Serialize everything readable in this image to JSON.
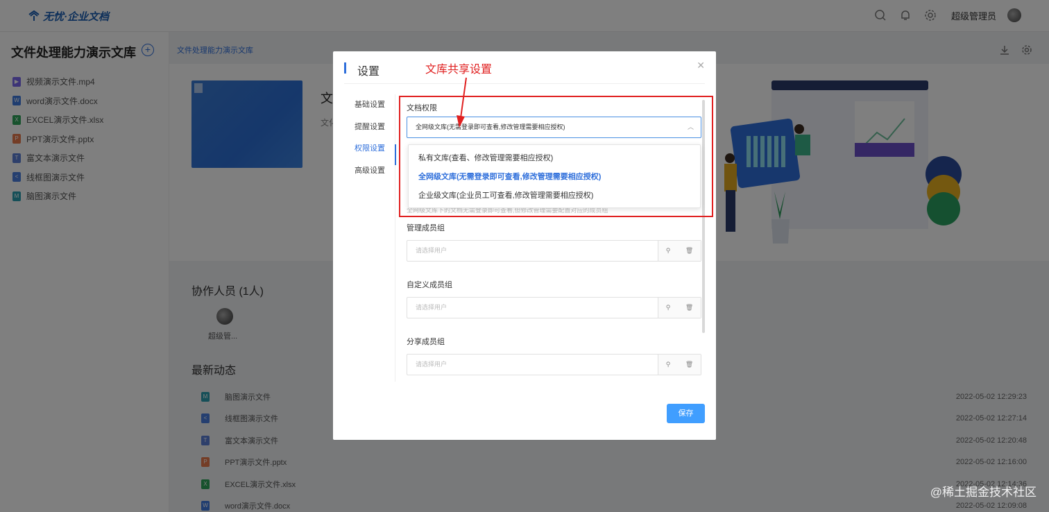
{
  "header": {
    "logo_text": "无忧·企业文档",
    "user_name": "超级管理员"
  },
  "sidebar": {
    "title": "文件处理能力演示文库",
    "files": [
      {
        "name": "视频演示文件.mp4",
        "color": "#7b68ee",
        "glyph": "▶"
      },
      {
        "name": "word演示文件.docx",
        "color": "#3f7be0",
        "glyph": "W"
      },
      {
        "name": "EXCEL演示文件.xlsx",
        "color": "#2fa55a",
        "glyph": "X"
      },
      {
        "name": "PPT演示文件.pptx",
        "color": "#e87a4d",
        "glyph": "P"
      },
      {
        "name": "富文本演示文件",
        "color": "#5b7fd6",
        "glyph": "T"
      },
      {
        "name": "线框图演示文件",
        "color": "#4a7fe0",
        "glyph": "<"
      },
      {
        "name": "脑图演示文件",
        "color": "#2a9fb0",
        "glyph": "M"
      }
    ]
  },
  "main": {
    "breadcrumb": "文件处理能力演示文库",
    "doc_title": "文",
    "doc_sub": "文化",
    "collaborators_title": "协作人员 (1人)",
    "collaborator_name": "超级管...",
    "news_title": "最新动态",
    "news": [
      {
        "name": "脑图演示文件",
        "time": "2022-05-02 12:29:23",
        "color": "#2a9fb0",
        "glyph": "M"
      },
      {
        "name": "线框图演示文件",
        "time": "2022-05-02 12:27:14",
        "color": "#4a7fe0",
        "glyph": "<"
      },
      {
        "name": "富文本演示文件",
        "time": "2022-05-02 12:20:48",
        "color": "#5b7fd6",
        "glyph": "T"
      },
      {
        "name": "PPT演示文件.pptx",
        "time": "2022-05-02 12:16:00",
        "color": "#e87a4d",
        "glyph": "P"
      },
      {
        "name": "EXCEL演示文件.xlsx",
        "time": "2022-05-02 12:14:36",
        "color": "#2fa55a",
        "glyph": "X"
      },
      {
        "name": "word演示文件.docx",
        "time": "2022-05-02 12:09:08",
        "color": "#3f7be0",
        "glyph": "W"
      }
    ]
  },
  "modal": {
    "title": "设置",
    "nav": [
      "基础设置",
      "提醒设置",
      "权限设置",
      "高级设置"
    ],
    "active_nav": 2,
    "permission_label": "文档权限",
    "permission_value": "全网级文库(无需登录即可查看,修改管理需要相应授权)",
    "options": [
      "私有文库(查看、修改管理需要相应授权)",
      "全网级文库(无需登录即可查看,修改管理需要相应授权)",
      "企业级文库(企业员工可查看,修改管理需要相应授权)"
    ],
    "selected_option": 1,
    "hint": "全网级文库下的文档无需登录即可查看,但修改管理需要配置对应的成员组",
    "groups": [
      {
        "label": "管理成员组",
        "placeholder": "请选择用户"
      },
      {
        "label": "自定义成员组",
        "placeholder": "请选择用户"
      },
      {
        "label": "分享成员组",
        "placeholder": "请选择用户"
      }
    ],
    "save_label": "保存"
  },
  "annotation": {
    "text": "文库共享设置",
    "color": "#e02020"
  },
  "watermark": "@稀土掘金技术社区"
}
